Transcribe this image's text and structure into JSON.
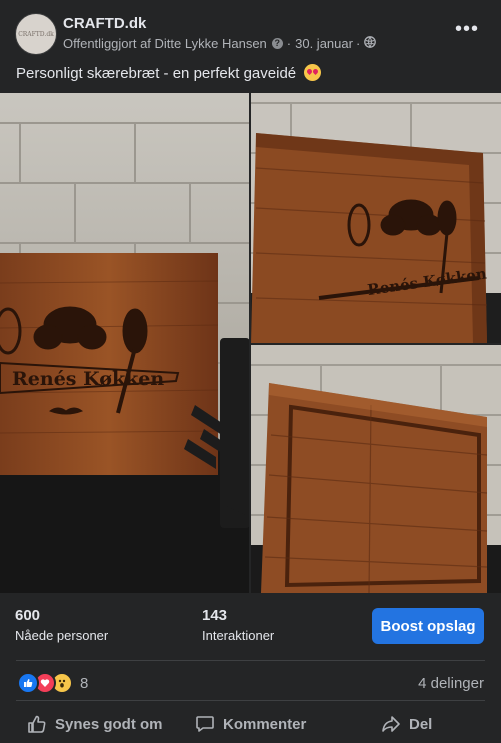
{
  "post": {
    "page_name": "CRAFTD.dk",
    "avatar_text": "CRAFTD.dk",
    "published_by": "Offentliggjort af Ditte Lykke Hansen",
    "date": "30. januar",
    "separator": "·",
    "caption": "Personligt skærebræt - en perfekt gaveidé",
    "engraving_text": "Renés Køkken"
  },
  "stats": {
    "reach_value": "600",
    "reach_label": "Nåede personer",
    "interactions_value": "143",
    "interactions_label": "Interaktioner",
    "boost_label": "Boost opslag"
  },
  "reactions": {
    "count": "8",
    "shares": "4 delinger",
    "types": [
      "like",
      "love",
      "wow"
    ]
  },
  "actions": {
    "like": "Synes godt om",
    "comment": "Kommenter",
    "share": "Del"
  },
  "colors": {
    "background": "#242526",
    "accent": "#2374e1",
    "text": "#e4e6eb",
    "secondary_text": "#b0b3b8"
  }
}
